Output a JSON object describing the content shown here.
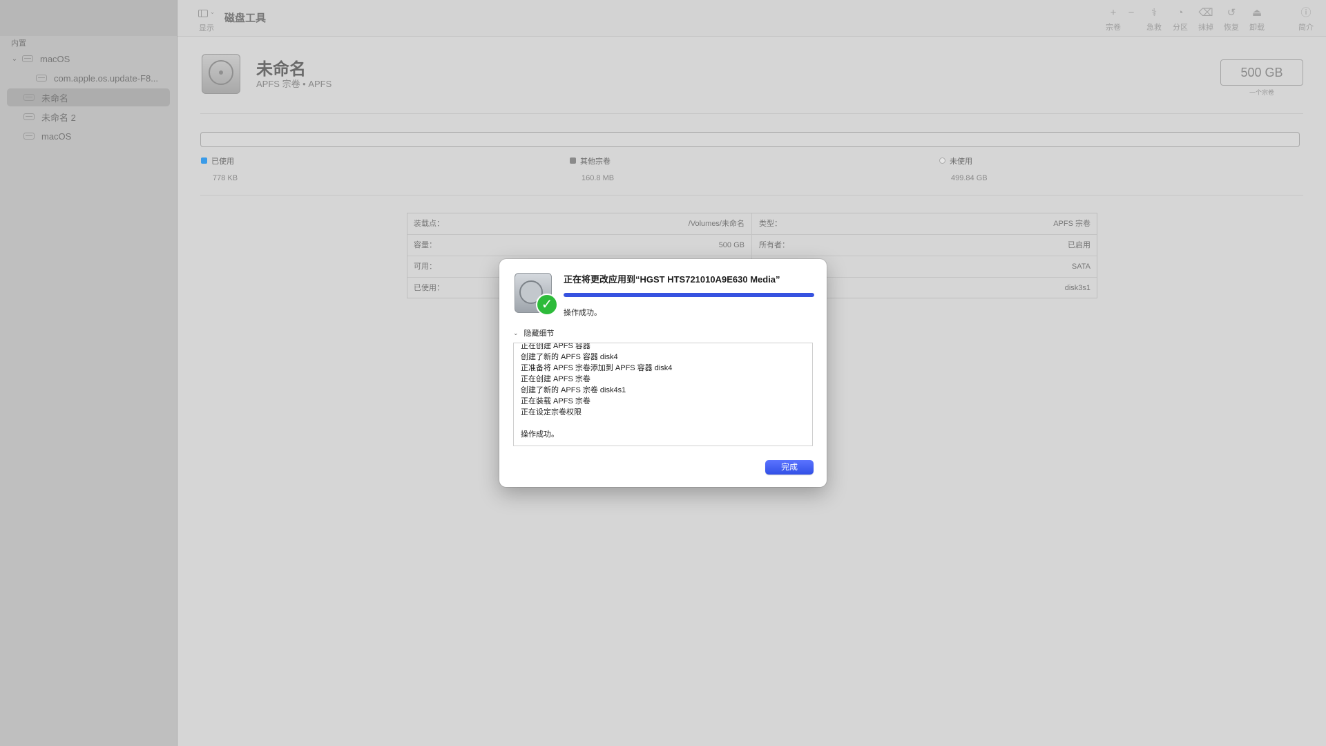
{
  "app": {
    "title": "磁盘工具"
  },
  "toolbar": {
    "view_label": "显示",
    "buttons": [
      {
        "icon": "plus",
        "label": "宗卷"
      },
      {
        "icon": "minus",
        "label": ""
      },
      {
        "icon": "first-aid",
        "label": "急救"
      },
      {
        "icon": "partition",
        "label": "分区"
      },
      {
        "icon": "erase",
        "label": "抹掉"
      },
      {
        "icon": "restore",
        "label": "恢复"
      },
      {
        "icon": "unmount",
        "label": "卸载"
      },
      {
        "icon": "info",
        "label": "简介"
      }
    ]
  },
  "sidebar": {
    "section": "内置",
    "items": [
      {
        "label": "macOS"
      },
      {
        "label": "com.apple.os.update-F8..."
      },
      {
        "label": "未命名"
      },
      {
        "label": "未命名 2"
      },
      {
        "label": "macOS"
      }
    ]
  },
  "volume": {
    "name": "未命名",
    "subtitle": "APFS 宗卷 • APFS",
    "size": "500 GB",
    "size_sub": "一个宗卷"
  },
  "usage": {
    "used": {
      "label": "已使用",
      "value": "778 KB",
      "color": "#3a9be8"
    },
    "other": {
      "label": "其他宗卷",
      "value": "160.8 MB",
      "color": "#8a8a8a"
    },
    "free": {
      "label": "未使用",
      "value": "499.84 GB",
      "color": "#ffffff"
    }
  },
  "info": {
    "rows": [
      {
        "k1": "装载点：",
        "v1": "/Volumes/未命名",
        "k2": "类型：",
        "v2": "APFS 宗卷"
      },
      {
        "k1": "容量：",
        "v1": "500 GB",
        "k2": "所有者：",
        "v2": "已启用"
      },
      {
        "k1": "可用：",
        "v1": "",
        "k2": "",
        "v2": "SATA"
      },
      {
        "k1": "已使用：",
        "v1": "",
        "k2": "",
        "v2": "disk3s1"
      }
    ]
  },
  "dialog": {
    "title": "正在将更改应用到“HGST HTS721010A9E630 Media”",
    "progress": 1.0,
    "status": "操作成功。",
    "details_toggle": "隐藏细节",
    "log": [
      "正在创建 APFS 容器",
      "创建了新的 APFS 容器 disk4",
      "正准备将 APFS 宗卷添加到 APFS 容器 disk4",
      "正在创建 APFS 宗卷",
      "创建了新的 APFS 宗卷 disk4s1",
      "正在装载 APFS 宗卷",
      "正在设定宗卷权限",
      "",
      "操作成功。"
    ],
    "done_button": "完成"
  }
}
